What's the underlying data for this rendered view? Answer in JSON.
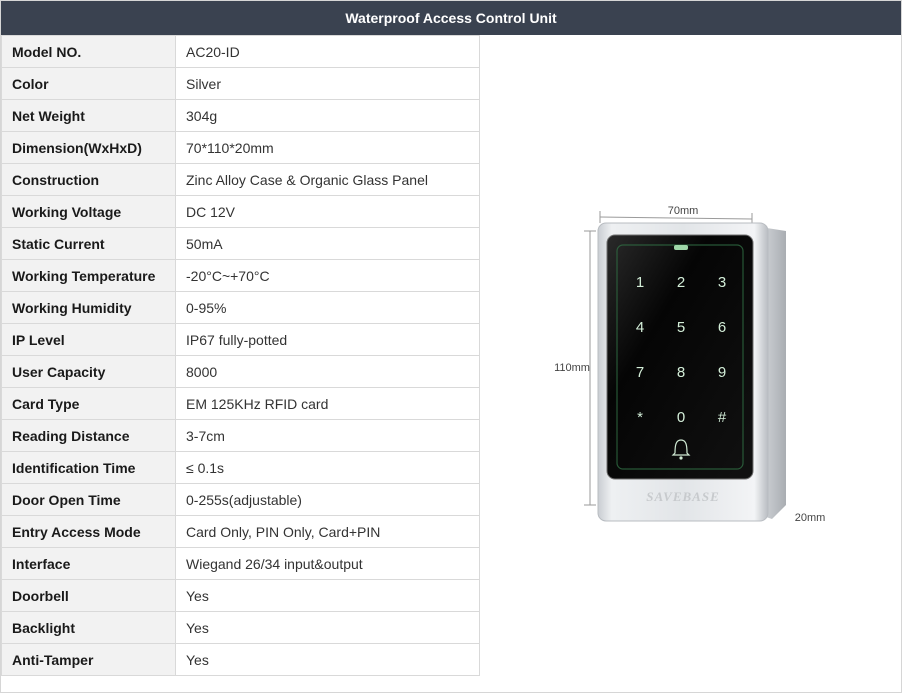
{
  "header": {
    "title": "Waterproof Access Control Unit"
  },
  "specs": [
    {
      "label": "Model NO.",
      "value": "AC20-ID"
    },
    {
      "label": "Color",
      "value": "Silver"
    },
    {
      "label": "Net Weight",
      "value": "304g"
    },
    {
      "label": "Dimension(WxHxD)",
      "value": "70*110*20mm"
    },
    {
      "label": "Construction",
      "value": "Zinc Alloy Case & Organic Glass Panel"
    },
    {
      "label": "Working Voltage",
      "value": "DC 12V"
    },
    {
      "label": "Static Current",
      "value": "50mA"
    },
    {
      "label": "Working Temperature",
      "value": "-20°C~+70°C"
    },
    {
      "label": "Working Humidity",
      "value": "0-95%"
    },
    {
      "label": "IP Level",
      "value": "IP67 fully-potted"
    },
    {
      "label": "User Capacity",
      "value": "8000"
    },
    {
      "label": "Card Type",
      "value": "EM 125KHz RFID card"
    },
    {
      "label": "Reading Distance",
      "value": "3-7cm"
    },
    {
      "label": "Identification Time",
      "value": "≤ 0.1s"
    },
    {
      "label": "Door Open Time",
      "value": "0-255s(adjustable)"
    },
    {
      "label": "Entry Access Mode",
      "value": "Card Only, PIN Only, Card+PIN"
    },
    {
      "label": "Interface",
      "value": "Wiegand 26/34 input&output"
    },
    {
      "label": "Doorbell",
      "value": "Yes"
    },
    {
      "label": "Backlight",
      "value": "Yes"
    },
    {
      "label": "Anti-Tamper",
      "value": "Yes"
    }
  ],
  "product_image": {
    "width_label": "70mm",
    "height_label": "110mm",
    "depth_label": "20mm",
    "brand_text": "SAVEBASE",
    "keypad": [
      "1",
      "2",
      "3",
      "4",
      "5",
      "6",
      "7",
      "8",
      "9",
      "*",
      "0",
      "#"
    ],
    "doorbell_icon": "bell-icon",
    "colors": {
      "title_bar": "#3a4250",
      "label_cell": "#f2f2f2",
      "case": "#d9dce0",
      "panel": "#0a0a0a",
      "key_glow": "#bfe7c9"
    }
  }
}
